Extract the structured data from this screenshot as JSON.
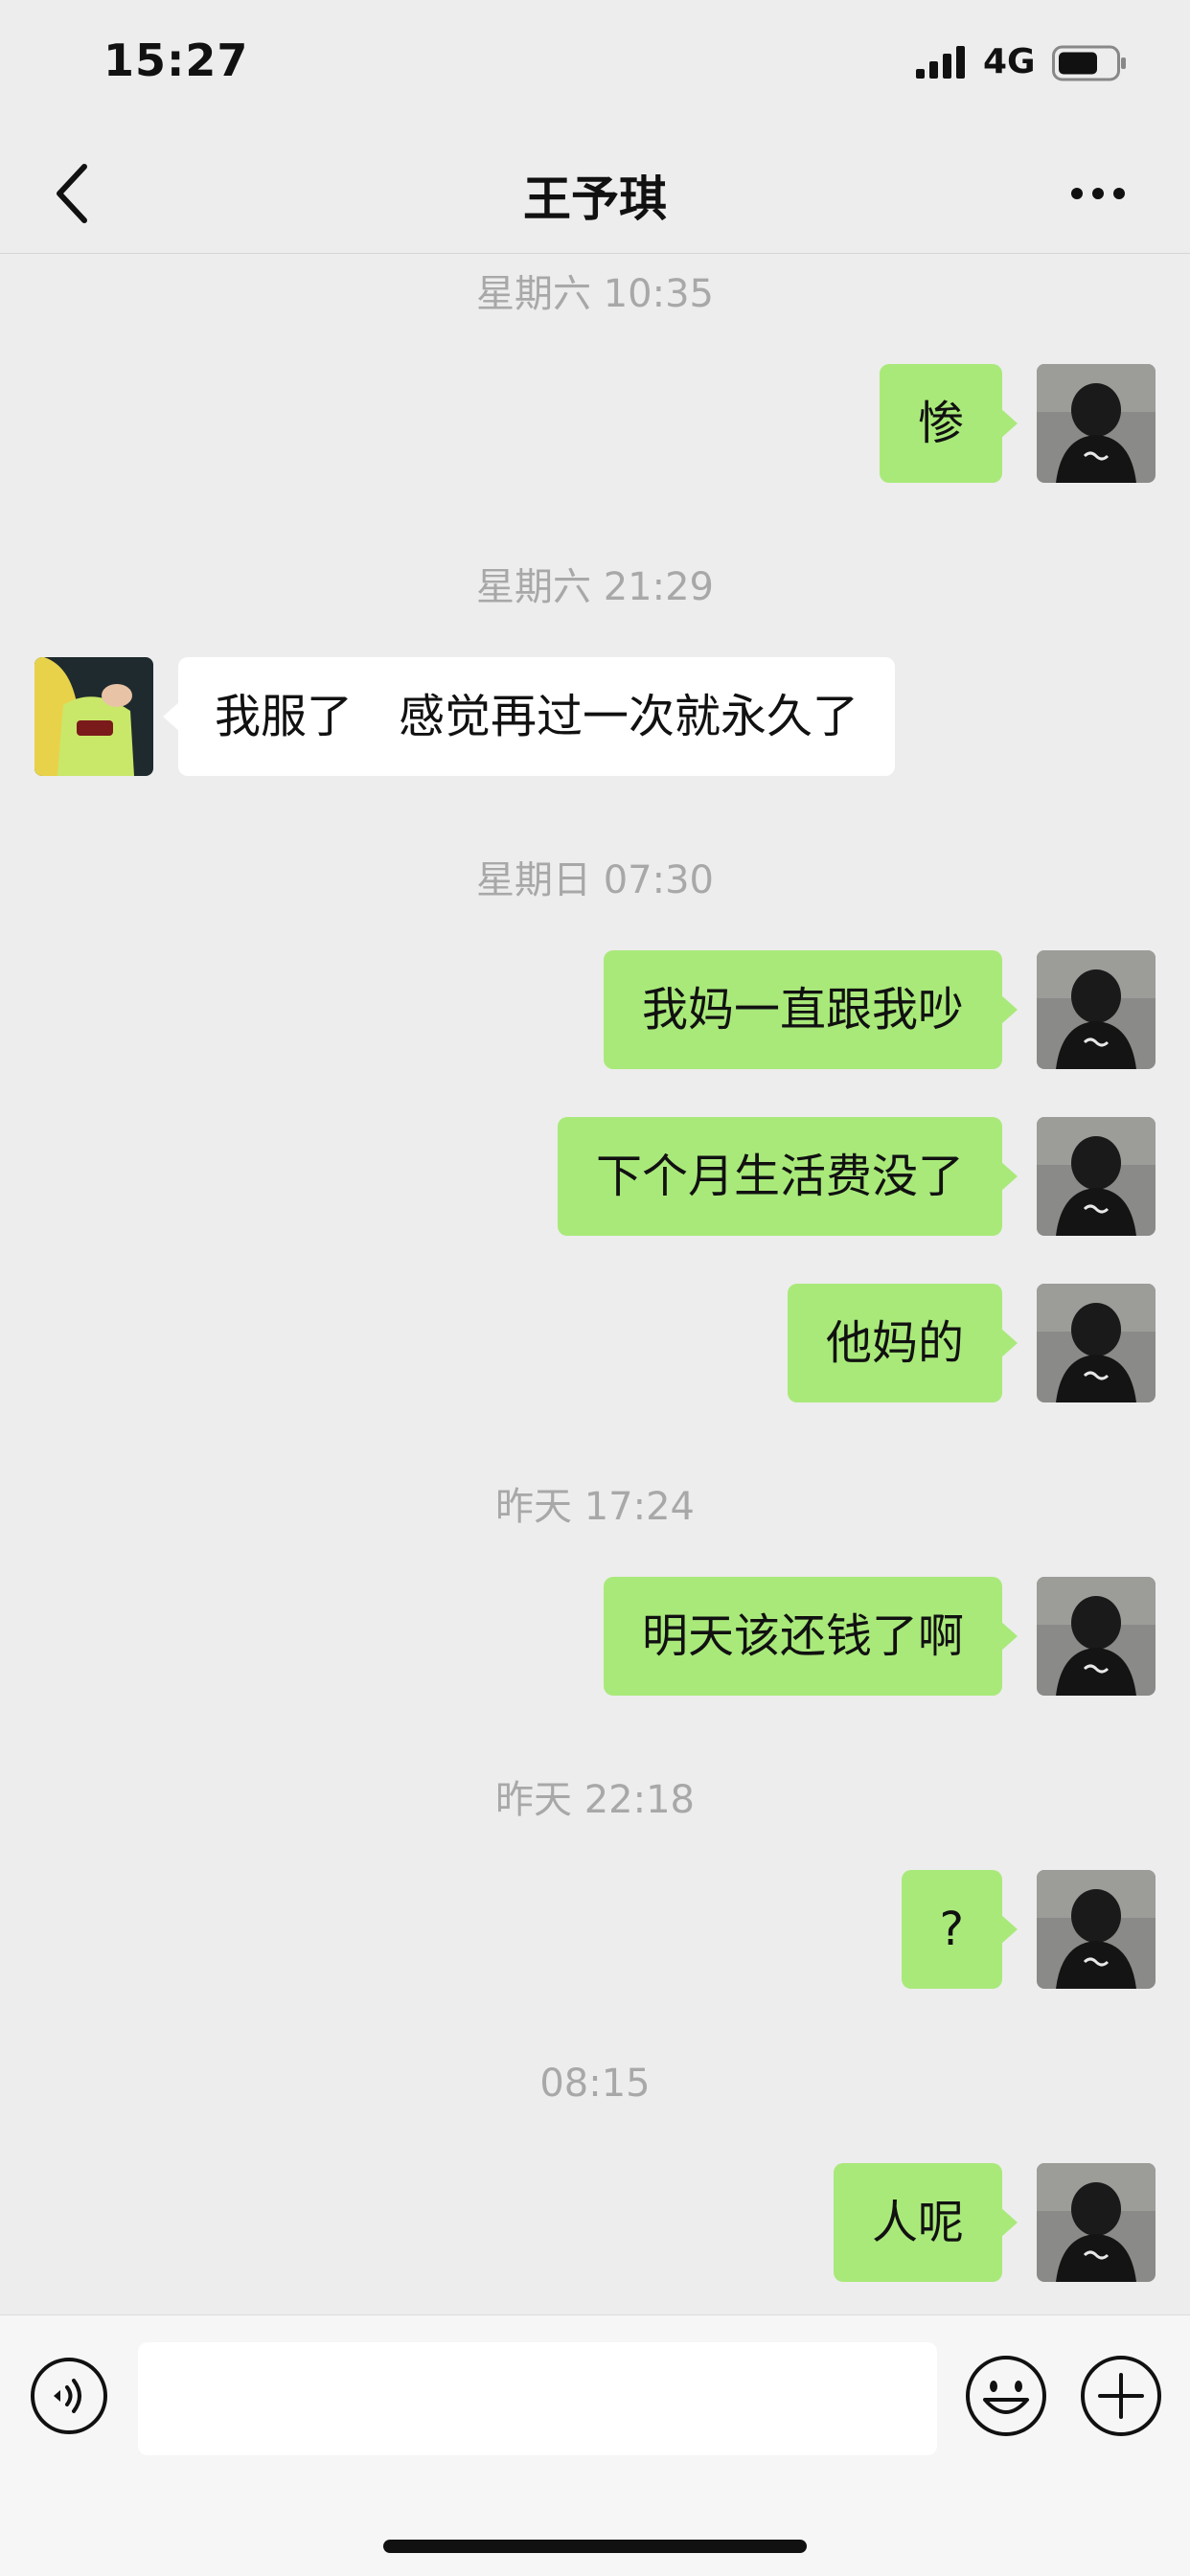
{
  "status_bar": {
    "time": "15:27",
    "network": "4G"
  },
  "header": {
    "title": "王予琪"
  },
  "messages": [
    {
      "type": "timestamp",
      "text": "星期六 10:35"
    },
    {
      "type": "sent",
      "text": "惨"
    },
    {
      "type": "timestamp",
      "text": "星期六 21:29"
    },
    {
      "type": "received",
      "text": "我服了　感觉再过一次就永久了"
    },
    {
      "type": "timestamp",
      "text": "星期日 07:30"
    },
    {
      "type": "sent",
      "text": "我妈一直跟我吵"
    },
    {
      "type": "sent",
      "text": "下个月生活费没了"
    },
    {
      "type": "sent",
      "text": "他妈的"
    },
    {
      "type": "timestamp",
      "text": "昨天 17:24"
    },
    {
      "type": "sent",
      "text": "明天该还钱了啊"
    },
    {
      "type": "timestamp",
      "text": "昨天 22:18"
    },
    {
      "type": "sent",
      "text": "?"
    },
    {
      "type": "timestamp",
      "text": "08:15"
    },
    {
      "type": "sent",
      "text": "人呢"
    }
  ],
  "input": {
    "value": "",
    "placeholder": ""
  },
  "icons": {
    "back": "back-chevron-icon",
    "more": "more-dots-icon",
    "voice": "voice-icon",
    "emoji": "emoji-icon",
    "plus": "plus-icon"
  },
  "colors": {
    "sent_bubble": "#a9e97a",
    "received_bubble": "#ffffff",
    "background": "#ededed",
    "timestamp_text": "#a8a8a8"
  }
}
